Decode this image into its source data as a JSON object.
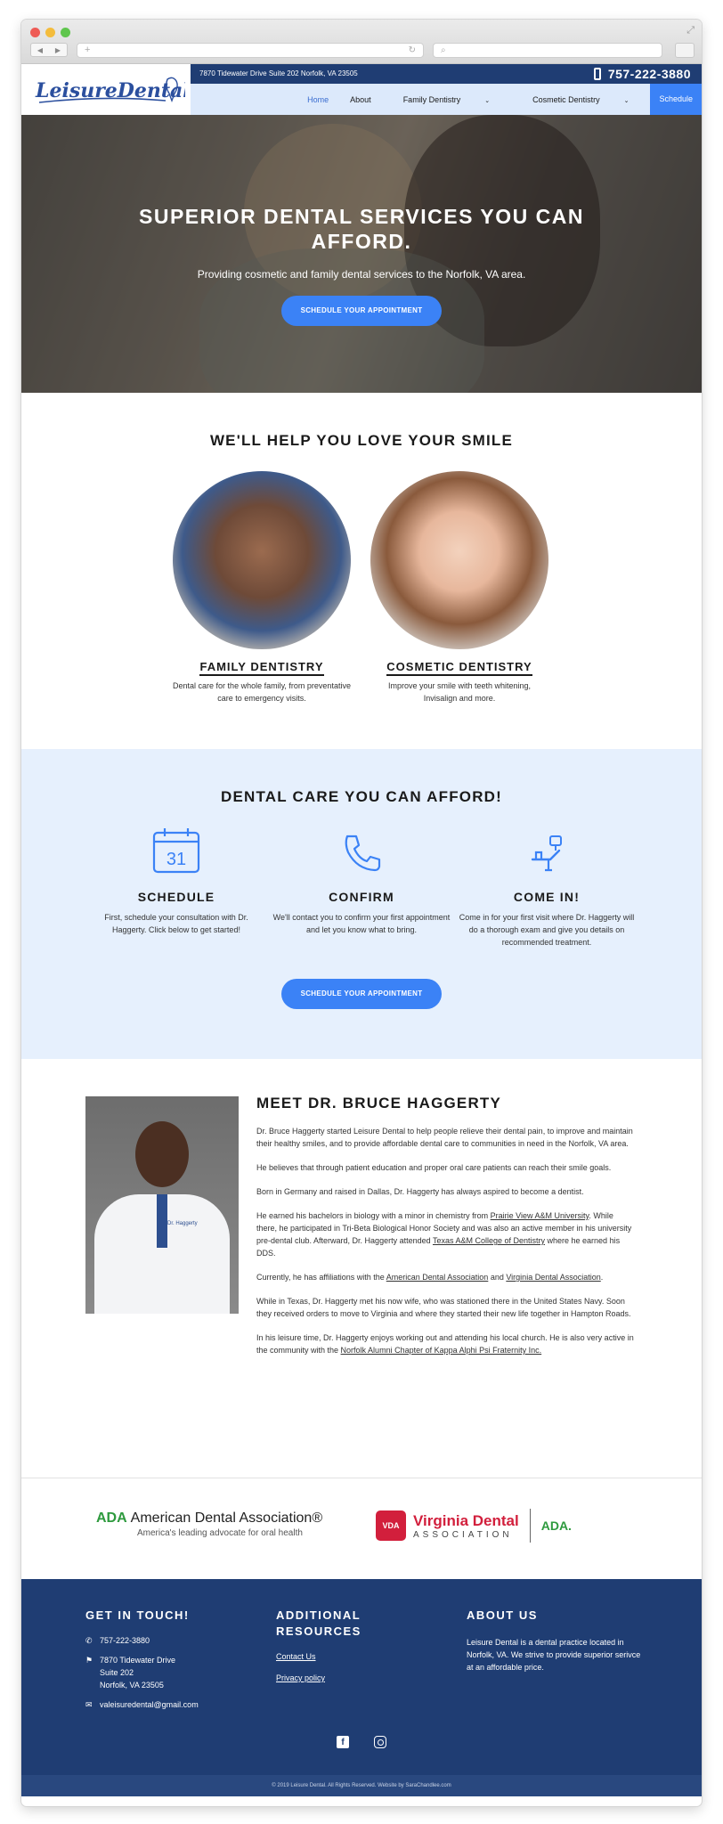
{
  "browser": {
    "reload_glyph": "↻",
    "search_glyph": "⌕",
    "add_tab": "+"
  },
  "header": {
    "logo_text": "LeisureDental",
    "address": "7870 Tidewater Drive Suite 202 Norfolk, VA 23505",
    "phone": "757-222-3880",
    "nav": [
      {
        "label": "Home"
      },
      {
        "label": "About"
      },
      {
        "label": "Family Dentistry"
      },
      {
        "label": "Cosmetic Dentistry"
      },
      {
        "label": "Schedule"
      }
    ]
  },
  "hero": {
    "title": "SUPERIOR DENTAL SERVICES YOU CAN AFFORD.",
    "subtitle": "Providing cosmetic and family dental services to the Norfolk, VA area.",
    "cta": "SCHEDULE YOUR APPOINTMENT"
  },
  "smile": {
    "title": "WE'LL HELP YOU LOVE YOUR SMILE",
    "services": [
      {
        "title": "FAMILY DENTISTRY",
        "desc": "Dental care for the whole family, from preventative care to emergency visits."
      },
      {
        "title": "COSMETIC DENTISTRY",
        "desc": "Improve your smile with teeth whitening, Invisalign and more."
      }
    ]
  },
  "afford": {
    "title": "DENTAL CARE YOU CAN AFFORD!",
    "calendar_day": "31",
    "steps": [
      {
        "title": "SCHEDULE",
        "desc": "First, schedule your consultation with Dr. Haggerty. Click below to get started!"
      },
      {
        "title": "CONFIRM",
        "desc": "We'll contact you to confirm your first appointment and let you know what to bring."
      },
      {
        "title": "COME IN!",
        "desc": "Come in for your first visit where Dr. Haggerty will do a thorough exam and give you details on recommended treatment."
      }
    ],
    "cta": "SCHEDULE YOUR APPOINTMENT"
  },
  "doctor": {
    "title": "MEET DR. BRUCE HAGGERTY",
    "coat_label": "Dr. Haggerty",
    "p1": "Dr. Bruce Haggerty started Leisure Dental to help people relieve their dental pain, to improve and maintain their healthy smiles, and to provide affordable dental care to communities in need in the Norfolk, VA area.",
    "p2": "He believes that through patient education and proper oral care patients can reach their smile goals.",
    "p3": "Born in Germany and raised in Dallas, Dr. Haggerty has always aspired to become a dentist.",
    "p4a": "He earned his bachelors in biology with a minor in chemistry from ",
    "p4_link1": "Prairie View A&M University",
    "p4b": ". While there, he participated in Tri-Beta Biological Honor Society and was also an active member in his university pre-dental club. Afterward, Dr. Haggerty attended ",
    "p4_link2": "Texas A&M College of Dentistry",
    "p4c": " where he earned his DDS.",
    "p5a": "Currently, he has affiliations with the ",
    "p5_link1": "American Dental Association",
    "p5b": " and ",
    "p5_link2": "Virginia Dental Association",
    "p5c": ".",
    "p6": "While in Texas, Dr. Haggerty met his now wife, who was stationed there in the United States Navy. Soon they received orders to move to Virginia and where they started their new life together in Hampton Roads.",
    "p7a": "In his leisure time, Dr. Haggerty enjoys working out and attending his local church. He is also very active in the community with the ",
    "p7_link": "Norfolk Alumni Chapter of Kappa Alphi Psi Fraternity Inc."
  },
  "logos": {
    "ada_abbr": "ADA",
    "ada_name": "American Dental Association®",
    "ada_tagline": "America's leading advocate for oral health",
    "vda_badge": "VDA",
    "vda_line1": "Virginia Dental",
    "vda_line2": "ASSOCIATION",
    "ada_small": "ADA."
  },
  "footer": {
    "contact_title": "GET IN TOUCH!",
    "phone": "757-222-3880",
    "address_1": "7870 Tidewater Drive",
    "address_2": "Suite 202",
    "address_3": "Norfolk, VA 23505",
    "email": "valeisuredental@gmail.com",
    "resources_title_1": "ADDITIONAL",
    "resources_title_2": "RESOURCES",
    "link_contact": "Contact Us",
    "link_privacy": "Privacy policy",
    "about_title": "ABOUT US",
    "about_text": "Leisure Dental is a dental practice located in Norfolk, VA. We strive to provide superior serivce at an affordable price.",
    "facebook_glyph": "f",
    "copyright": "© 2019 Leisure Dental. All Rights Reserved. Website by SaraChandlee.com"
  },
  "colors": {
    "accent": "#3b82f6",
    "navy": "#1f3d73",
    "light_blue": "#e6f0fd"
  }
}
